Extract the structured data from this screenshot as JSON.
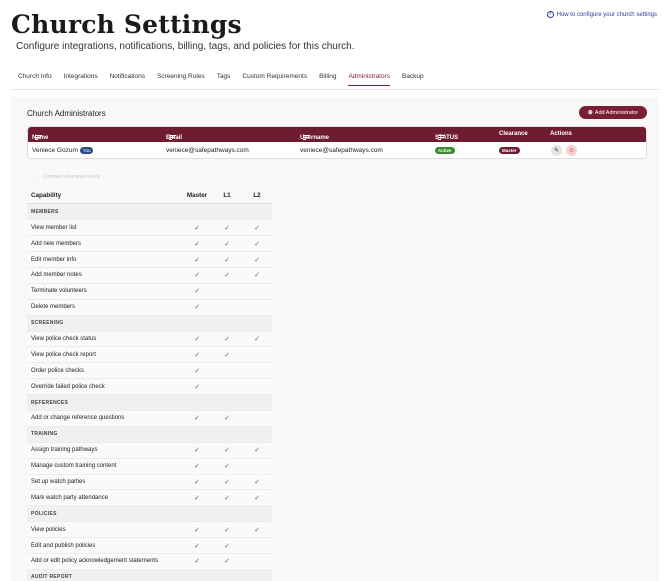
{
  "page": {
    "title": "Church Settings",
    "subtitle": "Configure integrations, notifications, billing, tags, and policies for this church.",
    "help_link": "How to configure your church settings"
  },
  "tabs": [
    {
      "label": "Church Info",
      "active": false
    },
    {
      "label": "Integrations",
      "active": false
    },
    {
      "label": "Notifications",
      "active": false
    },
    {
      "label": "Screening Rules",
      "active": false
    },
    {
      "label": "Tags",
      "active": false
    },
    {
      "label": "Custom Requirements",
      "active": false
    },
    {
      "label": "Billing",
      "active": false
    },
    {
      "label": "Administrators",
      "active": true
    },
    {
      "label": "Backup",
      "active": false
    }
  ],
  "admins": {
    "title": "Church Administrators",
    "add_button": "Add Administrator",
    "columns": {
      "name": "Name",
      "email": "Email",
      "username": "Username",
      "status": "STATUS",
      "clearance": "Clearance",
      "actions": "Actions"
    },
    "rows": [
      {
        "name": "Veniece Gozum",
        "you_badge": "You",
        "email": "veniece@safepathways.com",
        "username": "veniece@safepathways.com",
        "status": "Active",
        "clearance": "Master"
      }
    ]
  },
  "compare_link": "← Compare clearance levels",
  "capabilities": {
    "headers": {
      "capability": "Capability",
      "master": "Master",
      "l1": "L1",
      "l2": "L2"
    },
    "check_glyph": "✓",
    "rows": [
      {
        "type": "section",
        "label": "MEMBERS"
      },
      {
        "type": "item",
        "label": "View member list",
        "master": true,
        "l1": true,
        "l2": true
      },
      {
        "type": "item",
        "label": "Add new members",
        "master": true,
        "l1": true,
        "l2": true
      },
      {
        "type": "item",
        "label": "Edit member info",
        "master": true,
        "l1": true,
        "l2": true
      },
      {
        "type": "item",
        "label": "Add member notes",
        "master": true,
        "l1": true,
        "l2": true
      },
      {
        "type": "item",
        "label": "Terminate volunteers",
        "master": true,
        "l1": false,
        "l2": false
      },
      {
        "type": "item",
        "label": "Delete members",
        "master": true,
        "l1": false,
        "l2": false
      },
      {
        "type": "section",
        "label": "SCREENING"
      },
      {
        "type": "item",
        "label": "View police check status",
        "master": true,
        "l1": true,
        "l2": true
      },
      {
        "type": "item",
        "label": "View police check report",
        "master": true,
        "l1": true,
        "l2": false
      },
      {
        "type": "item",
        "label": "Order police checks",
        "master": true,
        "l1": false,
        "l2": false
      },
      {
        "type": "item",
        "label": "Override failed police check",
        "master": true,
        "l1": false,
        "l2": false
      },
      {
        "type": "section",
        "label": "REFERENCES"
      },
      {
        "type": "item",
        "label": "Add or change reference questions",
        "master": true,
        "l1": true,
        "l2": false
      },
      {
        "type": "section",
        "label": "TRAINING"
      },
      {
        "type": "item",
        "label": "Assign training pathways",
        "master": true,
        "l1": true,
        "l2": true
      },
      {
        "type": "item",
        "label": "Manage custom training content",
        "master": true,
        "l1": true,
        "l2": false
      },
      {
        "type": "item",
        "label": "Set up watch parties",
        "master": true,
        "l1": true,
        "l2": true
      },
      {
        "type": "item",
        "label": "Mark watch party attendance",
        "master": true,
        "l1": true,
        "l2": true
      },
      {
        "type": "section",
        "label": "POLICIES"
      },
      {
        "type": "item",
        "label": "View policies",
        "master": true,
        "l1": true,
        "l2": true
      },
      {
        "type": "item",
        "label": "Edit and publish policies",
        "master": true,
        "l1": true,
        "l2": false
      },
      {
        "type": "item",
        "label": "Add or edit policy acknowledgement statements",
        "master": true,
        "l1": true,
        "l2": false
      },
      {
        "type": "section",
        "label": "AUDIT REPORT"
      }
    ]
  }
}
